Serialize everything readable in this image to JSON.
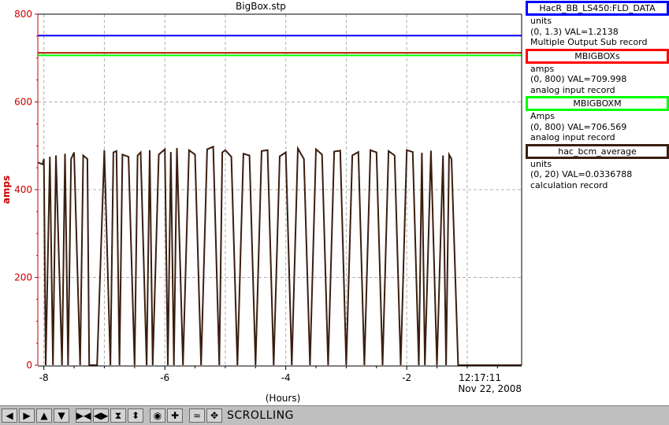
{
  "window": {
    "title": "BigBox.stp"
  },
  "legend": [
    {
      "name": "HacR_BB_LS450:FLD_DATA",
      "color": "#0000ff",
      "units": "units",
      "range_val": "(0, 1.3) VAL=1.2138",
      "record": "Multiple Output Sub record"
    },
    {
      "name": "MBIGBOXs",
      "color": "#ff0000",
      "units": "amps",
      "range_val": "(0, 800) VAL=709.998",
      "record": "analog input record"
    },
    {
      "name": "MBIGBOXM",
      "color": "#00ff00",
      "units": "Amps",
      "range_val": "(0, 800) VAL=706.569",
      "record": "analog input record"
    },
    {
      "name": "hac_bcm_average",
      "color": "#3a1e10",
      "units": "units",
      "range_val": "(0, 20) VAL=0.0336788",
      "record": "calculation record"
    }
  ],
  "toolbar": {
    "buttons": [
      {
        "name": "scroll-left-button",
        "icon": "arrow-left-icon",
        "glyph": "◀"
      },
      {
        "name": "scroll-right-button",
        "icon": "arrow-right-icon",
        "glyph": "▶"
      },
      {
        "name": "scroll-up-button",
        "icon": "arrow-up-icon",
        "glyph": "▲"
      },
      {
        "name": "scroll-down-button",
        "icon": "arrow-down-icon",
        "glyph": "▼"
      },
      {
        "name": "zoom-in-x-button",
        "icon": "zoom-in-x-icon",
        "glyph": "▶◀"
      },
      {
        "name": "zoom-out-x-button",
        "icon": "zoom-out-x-icon",
        "glyph": "◀▶"
      },
      {
        "name": "zoom-in-y-button",
        "icon": "zoom-in-y-icon",
        "glyph": "⧗"
      },
      {
        "name": "zoom-out-y-button",
        "icon": "zoom-out-y-icon",
        "glyph": "⬍"
      },
      {
        "name": "auto-scale-button",
        "icon": "target-icon",
        "glyph": "◉"
      },
      {
        "name": "add-button",
        "icon": "plus-icon",
        "glyph": "✚"
      },
      {
        "name": "scroll-mode-button",
        "icon": "scroll-mode-icon",
        "glyph": "≈"
      },
      {
        "name": "pan-button",
        "icon": "pan-icon",
        "glyph": "✥"
      }
    ],
    "status": "SCROLLING"
  },
  "chart_data": {
    "type": "line",
    "title": "BigBox.stp",
    "ylabel": "amps",
    "xlabel": "(Hours)",
    "xlim": [
      -8.1,
      -0.1
    ],
    "ylim": [
      0,
      800
    ],
    "x_ticks": [
      "-8",
      "-6",
      "-4",
      "-2"
    ],
    "x_tick_values": [
      -8,
      -6,
      -4,
      -2
    ],
    "y_ticks": [
      "0",
      "200",
      "400",
      "600",
      "800"
    ],
    "y_tick_values": [
      0,
      200,
      400,
      600,
      800
    ],
    "time_label": "12:17:11",
    "date_label": "Nov 22, 2008",
    "grid": true,
    "axis_color": "#cc0000",
    "series": [
      {
        "color": "#0000ff",
        "x": [
          -8.1,
          -0.1
        ],
        "y": [
          751,
          751
        ]
      },
      {
        "color": "#aa2200",
        "x": [
          -8.1,
          -0.1
        ],
        "y": [
          712,
          712
        ]
      },
      {
        "color": "#00ff00",
        "x": [
          -8.1,
          -0.1
        ],
        "y": [
          706,
          706
        ]
      },
      {
        "color": "#3a1e10",
        "x": [
          -8.1,
          -8.02,
          -8.0,
          -7.97,
          -7.9,
          -7.85,
          -7.8,
          -7.7,
          -7.65,
          -7.6,
          -7.55,
          -7.5,
          -7.4,
          -7.35,
          -7.28,
          -7.25,
          -7.18,
          -7.12,
          -7.0,
          -6.9,
          -6.85,
          -6.8,
          -6.75,
          -6.7,
          -6.6,
          -6.5,
          -6.45,
          -6.4,
          -6.3,
          -6.25,
          -6.2,
          -6.1,
          -6.0,
          -5.95,
          -5.9,
          -5.85,
          -5.8,
          -5.7,
          -5.6,
          -5.5,
          -5.4,
          -5.3,
          -5.2,
          -5.1,
          -5.05,
          -5.0,
          -4.9,
          -4.8,
          -4.7,
          -4.6,
          -4.5,
          -4.4,
          -4.3,
          -4.2,
          -4.1,
          -4.0,
          -3.9,
          -3.8,
          -3.7,
          -3.6,
          -3.5,
          -3.4,
          -3.3,
          -3.2,
          -3.1,
          -3.0,
          -2.9,
          -2.8,
          -2.7,
          -2.6,
          -2.5,
          -2.4,
          -2.3,
          -2.2,
          -2.1,
          -2.0,
          -1.9,
          -1.8,
          -1.75,
          -1.7,
          -1.6,
          -1.5,
          -1.4,
          -1.35,
          -1.3,
          -1.26,
          -1.15,
          -0.6,
          -0.1
        ],
        "y": [
          462,
          458,
          470,
          0,
          475,
          0,
          478,
          0,
          482,
          0,
          470,
          485,
          0,
          478,
          470,
          0,
          0,
          0,
          490,
          0,
          485,
          488,
          0,
          480,
          475,
          0,
          478,
          485,
          0,
          490,
          0,
          480,
          492,
          0,
          486,
          0,
          495,
          0,
          490,
          480,
          0,
          492,
          498,
          0,
          485,
          490,
          475,
          0,
          482,
          478,
          0,
          488,
          490,
          0,
          476,
          485,
          0,
          494,
          470,
          0,
          492,
          480,
          0,
          487,
          489,
          0,
          478,
          486,
          0,
          490,
          485,
          0,
          488,
          478,
          0,
          490,
          486,
          0,
          484,
          0,
          489,
          0,
          478,
          0,
          480,
          470,
          0,
          0,
          0
        ]
      }
    ]
  }
}
